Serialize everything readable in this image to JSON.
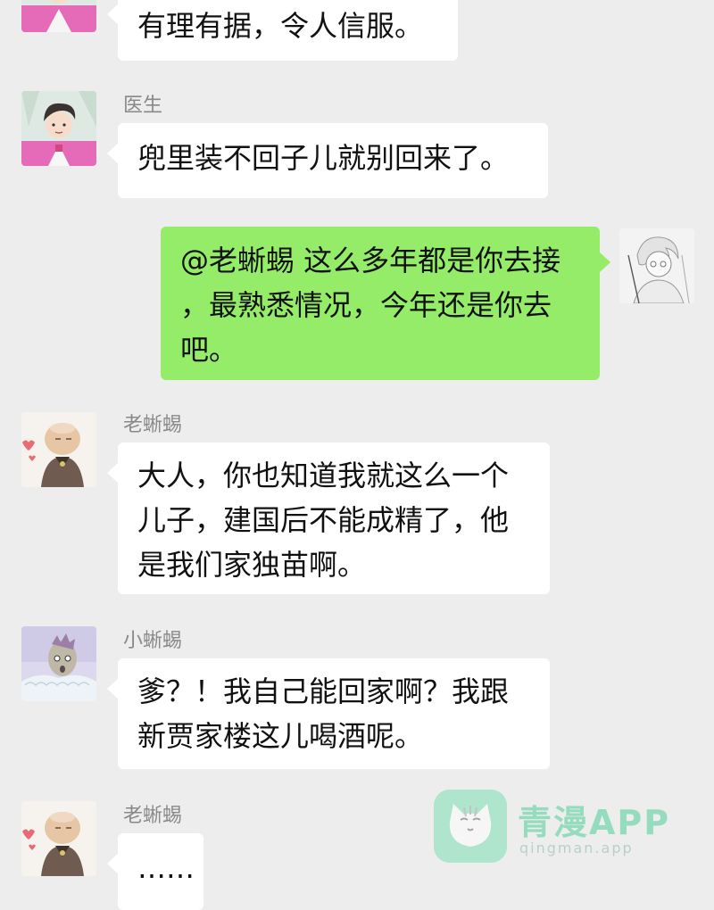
{
  "messages": [
    {
      "sender": "",
      "side": "left",
      "avatar": "doctor-avatar",
      "lines": [
        "有理有据，令人信服。"
      ]
    },
    {
      "sender": "医生",
      "side": "left",
      "avatar": "doctor-avatar",
      "lines": [
        "兜里装不回子儿就别回来了。"
      ]
    },
    {
      "sender": "",
      "side": "right",
      "avatar": "self-avatar",
      "lines": [
        "@老蜥蜴 这么多年都是你去接",
        "，最熟悉情况，今年还是你去",
        "吧。"
      ]
    },
    {
      "sender": "老蜥蜴",
      "side": "left",
      "avatar": "old-lizard-avatar",
      "lines": [
        "大人，你也知道我就这么一个",
        "儿子，建国后不能成精了，他",
        "是我们家独苗啊。"
      ]
    },
    {
      "sender": "小蜥蜴",
      "side": "left",
      "avatar": "young-lizard-avatar",
      "lines": [
        "爹？！我自己能回家啊？我跟",
        "新贾家楼这儿喝酒呢。"
      ]
    },
    {
      "sender": "老蜥蜴",
      "side": "left",
      "avatar": "old-lizard-avatar",
      "lines": [
        "……"
      ]
    }
  ],
  "watermark": {
    "title": "青漫APP",
    "subtitle": "qingman.app",
    "logo": "cat-logo-icon"
  },
  "colors": {
    "background": "#ededed",
    "bubble_other": "#ffffff",
    "bubble_self": "#95ec69",
    "sender_name": "#888888"
  }
}
